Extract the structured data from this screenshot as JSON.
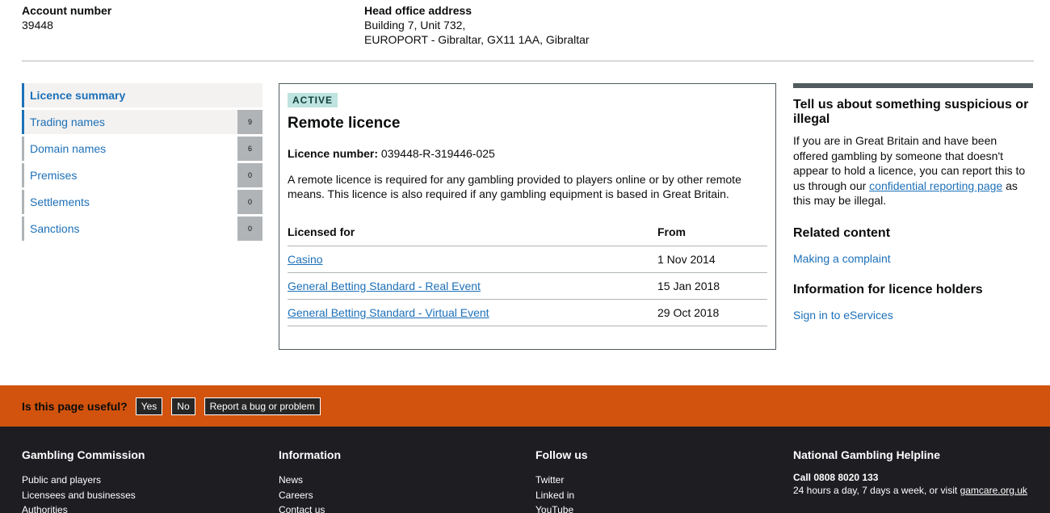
{
  "account": {
    "label": "Account number",
    "value": "39448"
  },
  "address": {
    "label": "Head office address",
    "line1": "Building 7, Unit 732,",
    "line2": "EUROPORT - Gibraltar, GX11 1AA, Gibraltar"
  },
  "nav": {
    "items": [
      {
        "label": "Licence summary",
        "count": null
      },
      {
        "label": "Trading names",
        "count": "9"
      },
      {
        "label": "Domain names",
        "count": "6"
      },
      {
        "label": "Premises",
        "count": "0"
      },
      {
        "label": "Settlements",
        "count": "0"
      },
      {
        "label": "Sanctions",
        "count": "0"
      }
    ]
  },
  "licence": {
    "status": "ACTIVE",
    "title": "Remote licence",
    "number_label": "Licence number:",
    "number": "039448-R-319446-025",
    "description": "A remote licence is required for any gambling provided to players online or by other remote means. This licence is also required if any gambling equipment is based in Great Britain.",
    "table": {
      "headers": [
        "Licensed for",
        "From"
      ],
      "rows": [
        {
          "activity": "Casino",
          "from": "1 Nov 2014"
        },
        {
          "activity": "General Betting Standard - Real Event",
          "from": "15 Jan 2018"
        },
        {
          "activity": "General Betting Standard - Virtual Event",
          "from": "29 Oct 2018"
        }
      ]
    }
  },
  "sidebar": {
    "report_title": "Tell us about something suspicious or illegal",
    "report_text_before": "If you are in Great Britain and have been offered gambling by someone that doesn't appear to hold a licence, you can report this to us through our ",
    "report_link": "confidential reporting page",
    "report_text_after": " as this may be illegal.",
    "related_title": "Related content",
    "related_link": "Making a complaint",
    "holders_title": "Information for licence holders",
    "holders_link": "Sign in to eServices"
  },
  "feedback": {
    "question": "Is this page useful?",
    "yes": "Yes",
    "no": "No",
    "report": "Report a bug or problem"
  },
  "footer": {
    "col1": {
      "title": "Gambling Commission",
      "links": [
        "Public and players",
        "Licensees and businesses",
        "Authorities"
      ]
    },
    "col2": {
      "title": "Information",
      "links": [
        "News",
        "Careers",
        "Contact us"
      ]
    },
    "col3": {
      "title": "Follow us",
      "links": [
        "Twitter",
        "Linked in",
        "YouTube"
      ]
    },
    "col4": {
      "title": "National Gambling Helpline",
      "call": "Call 0808 8020 133",
      "hours_text": "24 hours a day, 7 days a week, or visit ",
      "hours_link": "gamcare.org.uk"
    }
  },
  "colors": {
    "link": "#1d70b8",
    "feedback_bar": "#d2530d",
    "footer_bg": "#1d1d22",
    "status_tag_bg": "#bfe3e0"
  }
}
